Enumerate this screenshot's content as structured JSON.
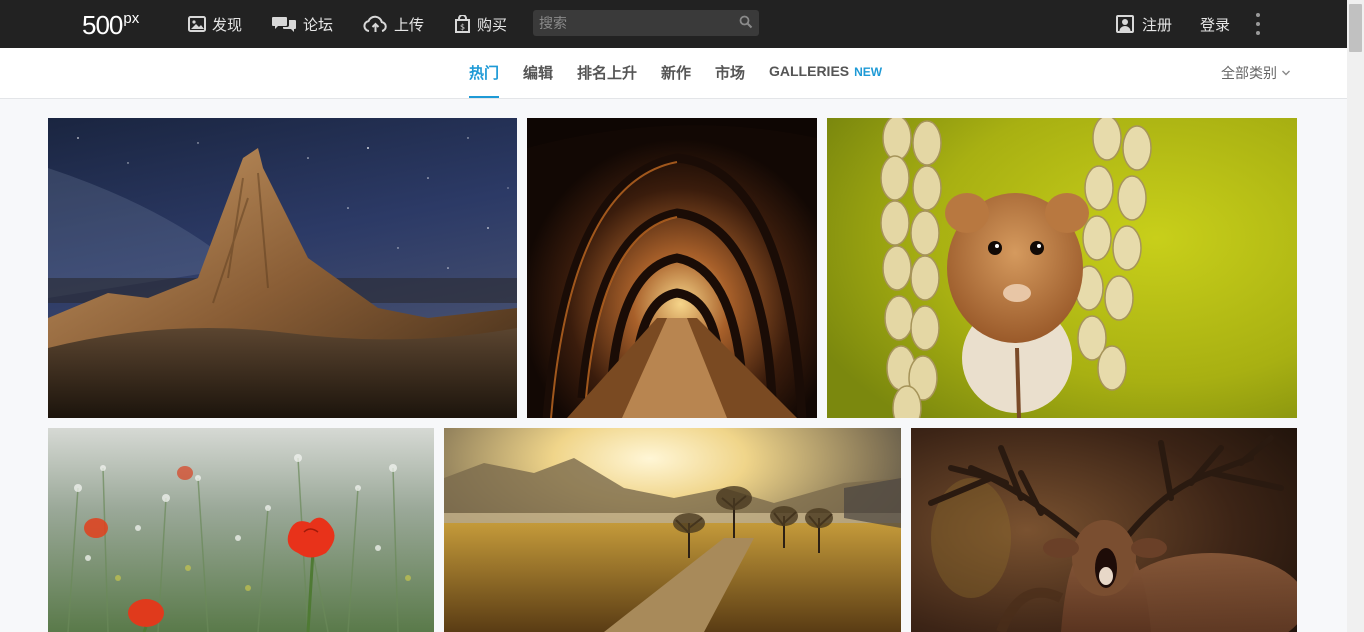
{
  "header": {
    "logo_main": "500",
    "logo_sup": "px",
    "nav": [
      {
        "label": "发现",
        "icon": "image-icon"
      },
      {
        "label": "论坛",
        "icon": "chat-bubbles-icon"
      },
      {
        "label": "上传",
        "icon": "cloud-upload-icon"
      },
      {
        "label": "购买",
        "icon": "shopping-bag-icon"
      }
    ],
    "search": {
      "placeholder": "搜索",
      "icon": "search-icon"
    },
    "register_label": "注册",
    "login_label": "登录",
    "more_icon": "vertical-dots-icon"
  },
  "subnav": {
    "tabs": [
      {
        "label": "热门",
        "active": true
      },
      {
        "label": "编辑",
        "active": false
      },
      {
        "label": "排名上升",
        "active": false
      },
      {
        "label": "新作",
        "active": false
      },
      {
        "label": "市场",
        "active": false
      },
      {
        "label": "GALLERIES",
        "badge": "NEW",
        "active": false
      }
    ],
    "category_label": "全部类别",
    "accent_color": "#1e9ad6"
  },
  "photos": [
    {
      "subject": "desert-butte-under-starry-night"
    },
    {
      "subject": "tree-tunnel-pathway-at-dusk"
    },
    {
      "subject": "harvest-mouse-between-wheat-stalks"
    },
    {
      "subject": "red-poppies-in-wildflower-meadow"
    },
    {
      "subject": "golden-sunrise-valley-road"
    },
    {
      "subject": "roaring-red-deer-stag"
    }
  ],
  "colors": {
    "topbar": "#222222",
    "background": "#f7f8fa"
  }
}
